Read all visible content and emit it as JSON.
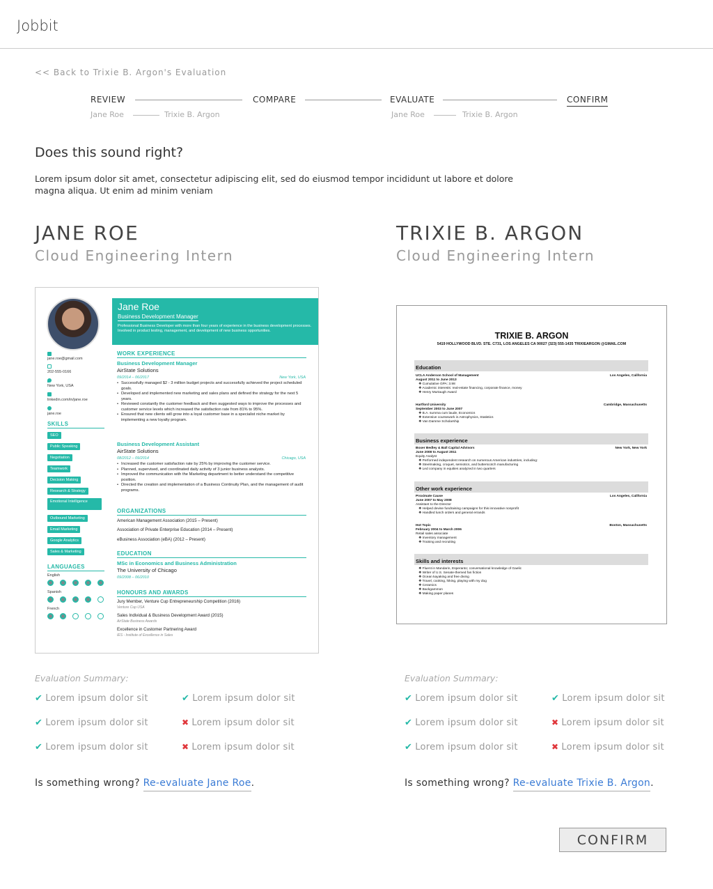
{
  "app": {
    "title": "Jobbit"
  },
  "nav": {
    "back_link": "<< Back to Trixie B. Argon's Evaluation"
  },
  "steps": [
    {
      "label": "REVIEW"
    },
    {
      "label": "COMPARE"
    },
    {
      "label": "EVALUATE"
    },
    {
      "label": "CONFIRM",
      "active": true
    }
  ],
  "step_subs": {
    "review_a": "Jane Roe",
    "review_b": "Trixie B. Argon",
    "evaluate_a": "Jane Roe",
    "evaluate_b": "Trixie B. Argon"
  },
  "main": {
    "question": "Does this sound right?",
    "lead": "Lorem ipsum dolor sit amet, consectetur adipiscing elit, sed do eiusmod tempor incididunt ut labore et dolore magna aliqua. Ut enim ad minim veniam"
  },
  "candidates": [
    {
      "name": "JANE ROE",
      "role": "Cloud Engineering Intern",
      "summary_label": "Evaluation Summary:",
      "summary": [
        {
          "text": "Lorem ipsum dolor sit",
          "ok": true
        },
        {
          "text": "Lorem ipsum dolor sit",
          "ok": true
        },
        {
          "text": "Lorem ipsum dolor sit",
          "ok": true
        },
        {
          "text": "Lorem ipsum dolor sit",
          "ok": false
        },
        {
          "text": "Lorem ipsum dolor sit",
          "ok": true
        },
        {
          "text": "Lorem ipsum dolor sit",
          "ok": false
        }
      ],
      "wrong_text": "Is something wrong?",
      "reeval_link": "Re-evaluate Jane Roe",
      "period": "."
    },
    {
      "name": "TRIXIE B. ARGON",
      "role": "Cloud Engineering Intern",
      "summary_label": "Evaluation Summary:",
      "summary": [
        {
          "text": "Lorem ipsum dolor sit",
          "ok": true
        },
        {
          "text": "Lorem ipsum dolor sit",
          "ok": true
        },
        {
          "text": "Lorem ipsum dolor sit",
          "ok": true
        },
        {
          "text": "Lorem ipsum dolor sit",
          "ok": false
        },
        {
          "text": "Lorem ipsum dolor sit",
          "ok": true
        },
        {
          "text": "Lorem ipsum dolor sit",
          "ok": false
        }
      ],
      "wrong_text": "Is something wrong?",
      "reeval_link": "Re-evaluate Trixie B. Argon",
      "period": "."
    }
  ],
  "resume_jane": {
    "name": "Jane Roe",
    "title": "Business Development Manager",
    "summary": "Professional Business Developer with more than four years of experience in the business development processes. Involved in product testing, management, and development of new business opportunities.",
    "contacts": [
      "jane.roe@gmail.com",
      "202-555-0166",
      "New York, USA",
      "linkedin.com/in/jane.roe",
      "jane.roe"
    ],
    "skills_label": "SKILLS",
    "skills": [
      "SEO",
      "Public Speaking",
      "Negotiation",
      "Teamwork",
      "Decision Making",
      "Research & Strategy",
      "Emotional Intelligence",
      "Outbound Marketing",
      "Email Marketing",
      "Google Analytics",
      "Sales & Marketing"
    ],
    "languages_label": "LANGUAGES",
    "languages": [
      {
        "name": "English",
        "level": 5
      },
      {
        "name": "Spanish",
        "level": 4
      },
      {
        "name": "French",
        "level": 2
      }
    ],
    "work_label": "WORK EXPERIENCE",
    "jobs": [
      {
        "title": "Business Development Manager",
        "company": "AirState Solutions",
        "dates": "09/2014 – 06/2017",
        "location": "New York, USA",
        "bullets": [
          "Successfully managed $2 - 3 million budget projects and successfully achieved the project scheduled goals.",
          "Developed and implemented new marketing and sales plans and defined the strategy for the next 5 years.",
          "Reviewed constantly the customer feedback and then suggested ways to improve the processes and customer service levels which increased the satisfaction rate from 81% to 95%.",
          "Ensured that new clients will grow into a loyal customer base in a specialist niche market by implementing a new loyalty program."
        ]
      },
      {
        "title": "Business Development Assistant",
        "company": "AirState Solutions",
        "dates": "08/2012 – 09/2014",
        "location": "Chicago, USA",
        "bullets": [
          "Increased the customer satisfaction rate by 25% by improving the customer service.",
          "Planned, supervised, and coordinated daily activity of 3 junior business analysts.",
          "Improved the communication with the Marketing department to better understand the competitive position.",
          "Directed the creation and implementation of a Business Continuity Plan, and the management of audit programs."
        ]
      }
    ],
    "org_label": "ORGANIZATIONS",
    "orgs": [
      "American Management Association (2015 – Present)",
      "Association of Private Enterprise Education (2014 – Present)",
      "eBusiness Association (eBA) (2012 – Present)"
    ],
    "edu_label": "EDUCATION",
    "edu_degree": "MSc in Economics and Business Administration",
    "edu_school": "The University of Chicago",
    "edu_dates": "09/2008 – 06/2010",
    "awards_label": "HONOURS AND AWARDS",
    "awards": [
      {
        "name": "Jury Member, Venture Cup Entrepreneurship Competition (2016)",
        "sub": "Venture Cup USA"
      },
      {
        "name": "Sales Individual & Business Development Award (2015)",
        "sub": "AirState Business Awards"
      },
      {
        "name": "Excellence in Customer Partnering Award",
        "sub": "IES - Institute of Excellence in Sales"
      }
    ]
  },
  "resume_trixie": {
    "name": "TRIXIE B. ARGON",
    "address": "5419 HOLLYWOOD BLVD. STE. C731, LOS ANGELES CA 90027     (323) 555-1435     TRIXIEARGON @GMAIL.COM",
    "sections": {
      "education": "Education",
      "business": "Business experience",
      "other": "Other work experience",
      "skills": "Skills and interests"
    },
    "edu": [
      {
        "org": "UCLA Anderson School of Management",
        "loc": "Los Angeles, California",
        "dates": "August 2011 to June 2013",
        "lines": [
          "Cumulative GPA: 3.98",
          "Academic interests: real-estate financing, corporate finance, money",
          "Henry Murtaugh Award"
        ]
      },
      {
        "org": "Hartford University",
        "loc": "Cambridge, Massachusetts",
        "dates": "September 2003 to June 2007",
        "lines": [
          "B.A. summa cum laude, Economics",
          "Extensive coursework in Astrophysics, Statistics",
          "Van Damme Scholarship"
        ]
      }
    ],
    "biz": {
      "org": "Boxer Bedley & Ball Capital Advisors",
      "loc": "New York, New York",
      "dates": "June 2008 to August 2011",
      "role": "Equity Analyst",
      "lines": [
        "Performed independent research on numerous American industries, including:",
        "Steelmaking, croquet, semiotics, and butterscotch manufacturing",
        "Led company in equities analyzed in two quarters"
      ]
    },
    "other": [
      {
        "org": "Proximate Cause",
        "loc": "Los Angeles, California",
        "dates": "June 2007 to May 2008",
        "role": "Assistant to the Director",
        "lines": [
          "Helped devise fundraising campaigns for this innovative nonprofit",
          "Handled lunch orders and general errands"
        ]
      },
      {
        "org": "Hot Topic",
        "loc": "Boston, Massachusetts",
        "dates": "February 2004 to March 2006",
        "role": "Retail sales associate",
        "lines": [
          "Inventory management",
          "Training and recruiting"
        ]
      }
    ],
    "skills": [
      "Fluent in Mandarin, Esperanto; conversational knowledge of Gaelic",
      "Writer of U.S. Senate-themed fan fiction",
      "Ocean kayaking and free diving",
      "Travel, cooking, hiking, playing with my dog",
      "Ceramics",
      "Backgammon",
      "Making paper planes"
    ]
  },
  "footer": {
    "confirm_label": "CONFIRM"
  },
  "colors": {
    "accent": "#25b9a8",
    "link": "#3a7bd5",
    "error": "#e0373c"
  }
}
